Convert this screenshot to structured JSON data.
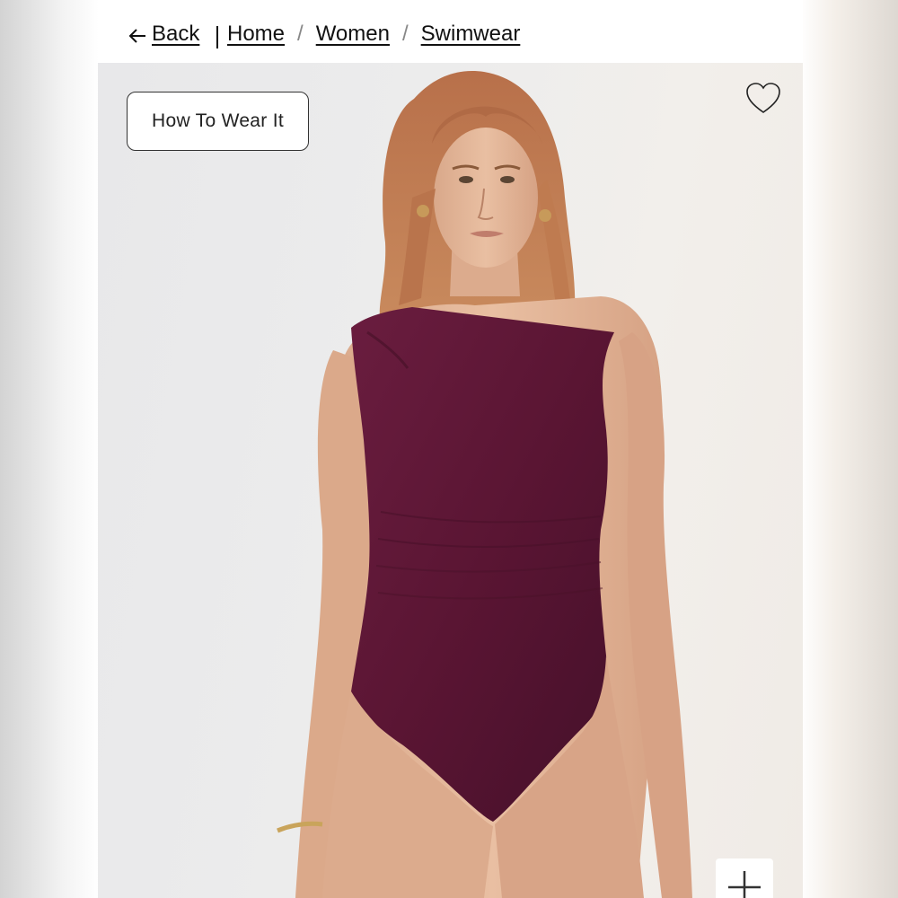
{
  "breadcrumb": {
    "back_label": "Back",
    "items": [
      {
        "label": "Home"
      },
      {
        "label": "Women"
      },
      {
        "label": "Swimwear"
      }
    ],
    "separator": "/"
  },
  "product_image": {
    "how_to_wear_label": "How To Wear It",
    "alt": "One-shoulder ruched swimsuit in burgundy",
    "swimsuit_color": "#5a1533"
  },
  "icons": {
    "back": "left-arrow-icon",
    "wishlist": "heart-icon",
    "zoom": "plus-icon"
  }
}
